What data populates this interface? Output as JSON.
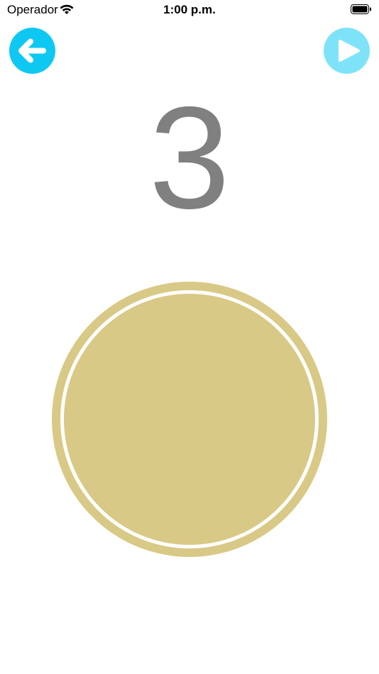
{
  "status_bar": {
    "carrier": "Operador",
    "time": "1:00 p.m.",
    "wifi_icon": "wifi-icon",
    "battery_icon": "battery-icon"
  },
  "nav": {
    "back_icon": "arrow-left-icon",
    "play_icon": "play-icon",
    "back_color": "#0ec8f2",
    "play_color": "#7ee3f9"
  },
  "counter": {
    "value": "3",
    "color": "#808080"
  },
  "circle": {
    "color": "#d9c986"
  }
}
